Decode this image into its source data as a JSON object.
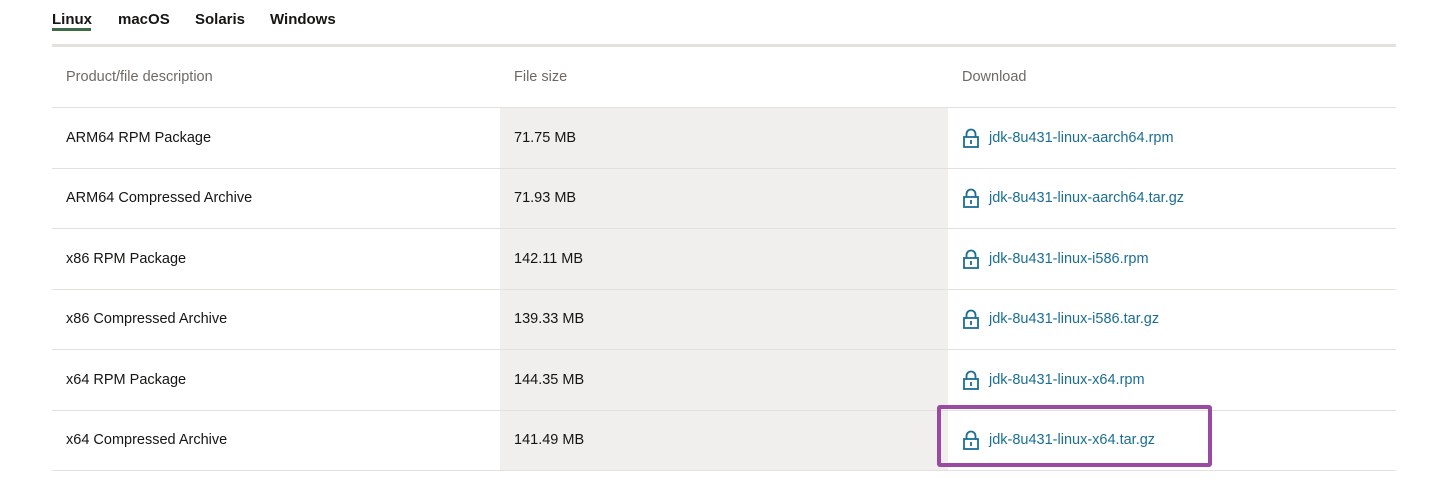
{
  "tabs": [
    {
      "label": "Linux",
      "active": true
    },
    {
      "label": "macOS",
      "active": false
    },
    {
      "label": "Solaris",
      "active": false
    },
    {
      "label": "Windows",
      "active": false
    }
  ],
  "table": {
    "headers": [
      "Product/file description",
      "File size",
      "Download"
    ],
    "rows": [
      {
        "description": "ARM64 RPM Package",
        "size": "71.75 MB",
        "file": "jdk-8u431-linux-aarch64.rpm"
      },
      {
        "description": "ARM64 Compressed Archive",
        "size": "71.93 MB",
        "file": "jdk-8u431-linux-aarch64.tar.gz"
      },
      {
        "description": "x86 RPM Package",
        "size": "142.11 MB",
        "file": "jdk-8u431-linux-i586.rpm"
      },
      {
        "description": "x86 Compressed Archive",
        "size": "139.33 MB",
        "file": "jdk-8u431-linux-i586.tar.gz"
      },
      {
        "description": "x64 RPM Package",
        "size": "144.35 MB",
        "file": "jdk-8u431-linux-x64.rpm"
      },
      {
        "description": "x64 Compressed Archive",
        "size": "141.49 MB",
        "file": "jdk-8u431-linux-x64.tar.gz"
      }
    ],
    "download_icon": "lock-icon"
  },
  "colors": {
    "active_tab_underline": "#3d6b45",
    "link": "#1b6e93",
    "highlight_box": "#9b4aa3",
    "shaded_column": "#f1efed"
  }
}
